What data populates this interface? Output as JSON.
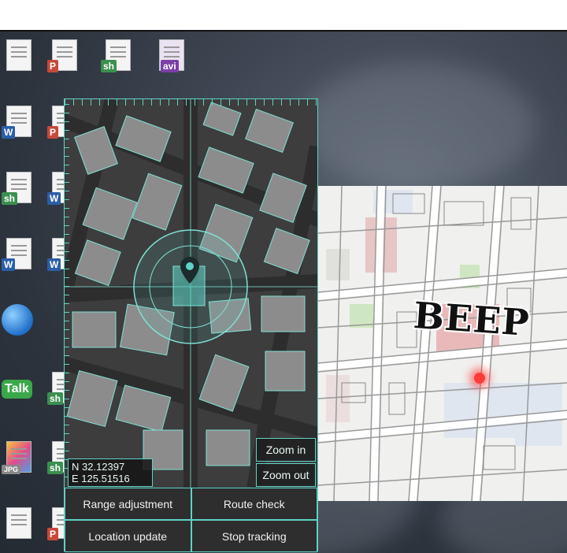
{
  "desktop_icons": [
    {
      "name": "doc-file-icon",
      "badge": ""
    },
    {
      "name": "ppt-file-icon",
      "badge": "P",
      "color": "#c7493a"
    },
    {
      "name": "sh-file-icon",
      "badge": "sh",
      "color": "#3b8f4f"
    },
    {
      "name": "avi-file-icon",
      "badge": "avi",
      "color": "#7b3fa6"
    },
    {
      "name": "word-file-icon",
      "badge": "W",
      "color": "#2b5ea8"
    },
    {
      "name": "ppt-file-icon",
      "badge": "P",
      "color": "#c7493a"
    },
    {
      "name": "sh-file-icon",
      "badge": "sh",
      "color": "#3b8f4f"
    },
    {
      "name": "word-file-icon",
      "badge": "W",
      "color": "#2b5ea8"
    },
    {
      "name": "word-file-icon",
      "badge": "W",
      "color": "#2b5ea8"
    },
    {
      "name": "word-file-icon",
      "badge": "W",
      "color": "#2b5ea8"
    },
    {
      "name": "globe-icon",
      "badge": ""
    },
    {
      "name": "talk-icon",
      "badge": "Talk",
      "color": "#3aa84a"
    },
    {
      "name": "sh-file-icon",
      "badge": "sh",
      "color": "#3b8f4f"
    },
    {
      "name": "jpg-file-icon",
      "badge": "JPG",
      "color": "#888888"
    },
    {
      "name": "sh-file-icon",
      "badge": "sh",
      "color": "#3b8f4f"
    },
    {
      "name": "ppt-file-icon",
      "badge": "P",
      "color": "#c7493a"
    },
    {
      "name": "ppt-file-icon",
      "badge": "P",
      "color": "#c7493a"
    }
  ],
  "tracker": {
    "coord_lat": "N 32.12397",
    "coord_lon": "E 125.51516",
    "zoom_in": "Zoom in",
    "zoom_out": "Zoom out",
    "actions": [
      "Range adjustment",
      "Route check",
      "Location update",
      "Stop tracking"
    ],
    "accent": "#5ed3c6"
  },
  "sfx": "BEEP"
}
